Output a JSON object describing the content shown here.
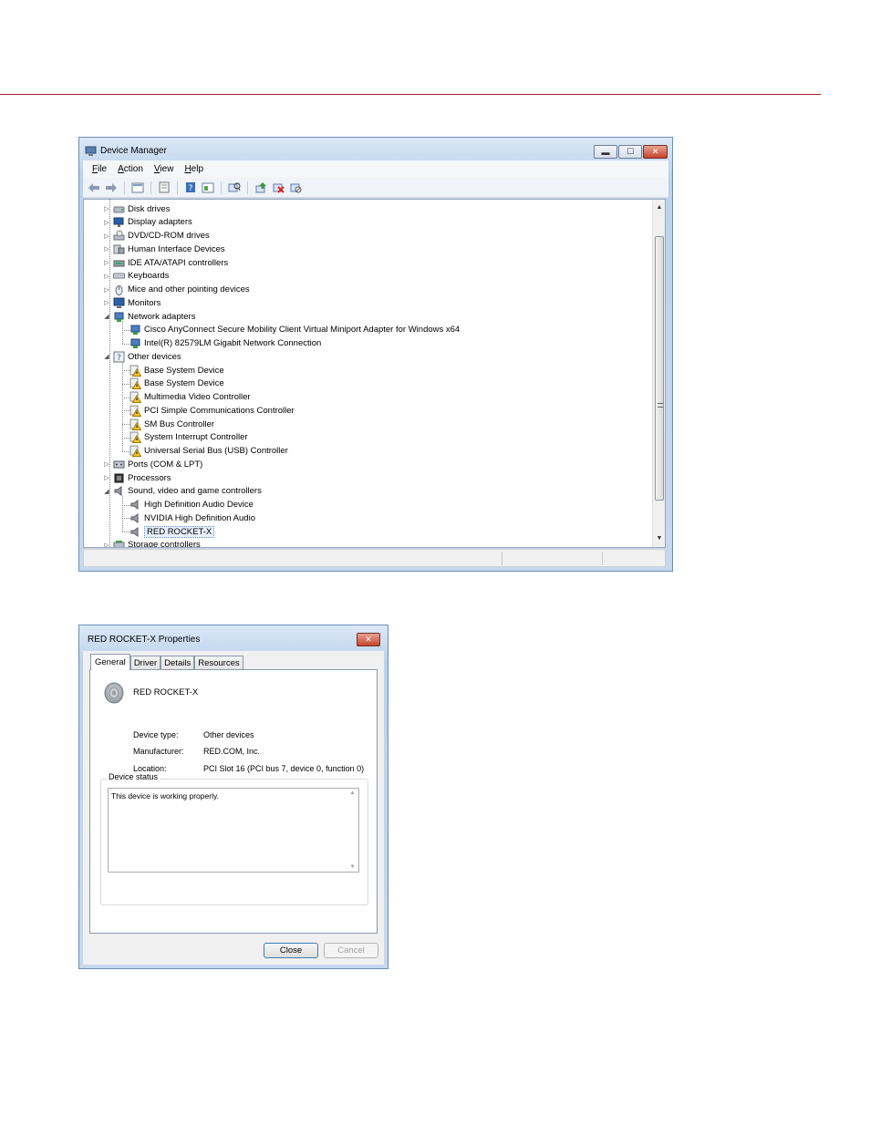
{
  "device_manager": {
    "title": "Device Manager",
    "menu": [
      {
        "label": "File",
        "accel": "F",
        "rest": "ile"
      },
      {
        "label": "Action",
        "accel": "A",
        "rest": "ction"
      },
      {
        "label": "View",
        "accel": "V",
        "rest": "iew"
      },
      {
        "label": "Help",
        "accel": "H",
        "rest": "elp"
      }
    ],
    "toolbar_icons": [
      "back-icon",
      "forward-icon",
      "properties-view-icon",
      "show-hidden-icon",
      "help-icon",
      "resources-view-icon",
      "scan-hardware-icon",
      "update-driver-icon",
      "uninstall-icon",
      "disable-icon"
    ],
    "tree": [
      {
        "label": "Disk drives",
        "level": 0,
        "expander": "▷",
        "icon": "disk-drive-icon"
      },
      {
        "label": "Display adapters",
        "level": 0,
        "expander": "▷",
        "icon": "display-adapter-icon"
      },
      {
        "label": "DVD/CD-ROM drives",
        "level": 0,
        "expander": "▷",
        "icon": "dvd-drive-icon"
      },
      {
        "label": "Human Interface Devices",
        "level": 0,
        "expander": "▷",
        "icon": "hid-icon"
      },
      {
        "label": "IDE ATA/ATAPI controllers",
        "level": 0,
        "expander": "▷",
        "icon": "ide-controller-icon"
      },
      {
        "label": "Keyboards",
        "level": 0,
        "expander": "▷",
        "icon": "keyboard-icon"
      },
      {
        "label": "Mice and other pointing devices",
        "level": 0,
        "expander": "▷",
        "icon": "mouse-icon"
      },
      {
        "label": "Monitors",
        "level": 0,
        "expander": "▷",
        "icon": "monitor-icon"
      },
      {
        "label": "Network adapters",
        "level": 0,
        "expander": "◢",
        "icon": "network-adapter-icon"
      },
      {
        "label": "Cisco AnyConnect Secure Mobility Client Virtual Miniport Adapter for Windows x64",
        "level": 1,
        "icon": "network-adapter-icon"
      },
      {
        "label": "Intel(R) 82579LM Gigabit Network Connection",
        "level": 1,
        "icon": "network-adapter-icon"
      },
      {
        "label": "Other devices",
        "level": 0,
        "expander": "◢",
        "icon": "unknown-device-icon"
      },
      {
        "label": "Base System Device",
        "level": 1,
        "icon": "warning-device-icon"
      },
      {
        "label": "Base System Device",
        "level": 1,
        "icon": "warning-device-icon"
      },
      {
        "label": "Multimedia Video Controller",
        "level": 1,
        "icon": "warning-device-icon"
      },
      {
        "label": "PCI Simple Communications Controller",
        "level": 1,
        "icon": "warning-device-icon"
      },
      {
        "label": "SM Bus Controller",
        "level": 1,
        "icon": "warning-device-icon"
      },
      {
        "label": "System Interrupt Controller",
        "level": 1,
        "icon": "warning-device-icon"
      },
      {
        "label": "Universal Serial Bus (USB) Controller",
        "level": 1,
        "icon": "warning-device-icon"
      },
      {
        "label": "Ports (COM & LPT)",
        "level": 0,
        "expander": "▷",
        "icon": "port-icon"
      },
      {
        "label": "Processors",
        "level": 0,
        "expander": "▷",
        "icon": "processor-icon"
      },
      {
        "label": "Sound, video and game controllers",
        "level": 0,
        "expander": "◢",
        "icon": "speaker-icon"
      },
      {
        "label": "High Definition Audio Device",
        "level": 1,
        "icon": "speaker-icon"
      },
      {
        "label": "NVIDIA High Definition Audio",
        "level": 1,
        "icon": "speaker-icon"
      },
      {
        "label": "RED ROCKET-X",
        "level": 1,
        "icon": "speaker-icon",
        "selected": true
      },
      {
        "label": "Storage controllers",
        "level": 0,
        "expander": "▷",
        "icon": "storage-controller-icon"
      }
    ]
  },
  "properties": {
    "title": "RED ROCKET-X Properties",
    "tabs": [
      "General",
      "Driver",
      "Details",
      "Resources"
    ],
    "active_tab": "General",
    "device_name": "RED ROCKET-X",
    "fields": [
      {
        "label": "Device type:",
        "value": "Other devices"
      },
      {
        "label": "Manufacturer:",
        "value": "RED.COM, Inc."
      },
      {
        "label": "Location:",
        "value": "PCI Slot 16 (PCI bus 7, device 0, function 0)"
      }
    ],
    "status_legend": "Device status",
    "status_text": "This device is working properly.",
    "close_label": "Close",
    "cancel_label": "Cancel"
  },
  "colors": {
    "rule": "#a8232a",
    "selection": "#e8f1fc",
    "window_frame": "#bcd2ec"
  }
}
